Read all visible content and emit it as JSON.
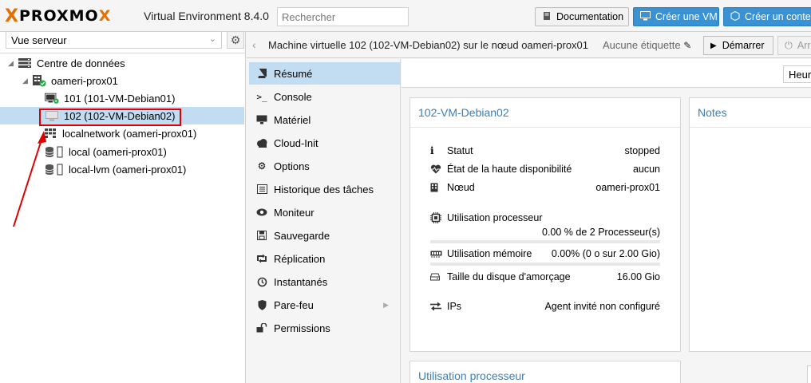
{
  "topbar": {
    "logo_x": "X",
    "logo_text": "PROXMO",
    "logo_x2": "X",
    "env": "Virtual Environment 8.4.0",
    "search_placeholder": "Rechercher",
    "doc_label": "Documentation",
    "create_vm_label": "Créer une VM",
    "create_ct_label": "Créer un conteneur"
  },
  "sidebar": {
    "view_selector": "Vue serveur",
    "tree": [
      {
        "label": "Centre de données",
        "icon": "server-rack-icon"
      },
      {
        "label": "oameri-prox01",
        "icon": "node-online-icon"
      },
      {
        "label": "101 (101-VM-Debian01)",
        "icon": "vm-running-icon"
      },
      {
        "label": "102 (102-VM-Debian02)",
        "icon": "vm-stopped-icon"
      },
      {
        "label": "localnetwork (oameri-prox01)",
        "icon": "network-grid-icon"
      },
      {
        "label": "local (oameri-prox01)",
        "icon": "storage-icon"
      },
      {
        "label": "local-lvm (oameri-prox01)",
        "icon": "storage-icon"
      }
    ]
  },
  "header": {
    "title": "Machine virtuelle 102 (102-VM-Debian02) sur le nœud oameri-prox01",
    "no_tag": "Aucune étiquette",
    "start_label": "Démarrer",
    "stop_label": "Arrêter"
  },
  "menu": [
    {
      "label": "Résumé",
      "icon": "book-icon",
      "selected": true
    },
    {
      "label": "Console",
      "icon": "terminal-icon"
    },
    {
      "label": "Matériel",
      "icon": "monitor-icon"
    },
    {
      "label": "Cloud-Init",
      "icon": "cloud-icon"
    },
    {
      "label": "Options",
      "icon": "gear-icon"
    },
    {
      "label": "Historique des tâches",
      "icon": "list-icon"
    },
    {
      "label": "Moniteur",
      "icon": "eye-icon"
    },
    {
      "label": "Sauvegarde",
      "icon": "floppy-icon"
    },
    {
      "label": "Réplication",
      "icon": "retweet-icon"
    },
    {
      "label": "Instantanés",
      "icon": "history-icon"
    },
    {
      "label": "Pare-feu",
      "icon": "shield-icon"
    },
    {
      "label": "Permissions",
      "icon": "unlock-icon"
    }
  ],
  "toolbar": {
    "timeframe": "Heure"
  },
  "summary": {
    "title": "102-VM-Debian02",
    "rows": {
      "status": {
        "label": "Statut",
        "value": "stopped"
      },
      "ha": {
        "label": "État de la haute disponibilité",
        "value": "aucun"
      },
      "node": {
        "label": "Nœud",
        "value": "oameri-prox01"
      },
      "cpu": {
        "label": "Utilisation processeur",
        "value": "0.00 % de 2 Processeur(s)",
        "fraction": 0
      },
      "mem": {
        "label": "Utilisation mémoire",
        "value": "0.00% (0 o sur 2.00 Gio)",
        "fraction": 0
      },
      "disk": {
        "label": "Taille du disque d'amorçage",
        "value": "16.00 Gio"
      },
      "ips": {
        "label": "IPs",
        "value": "Agent invité non configuré"
      }
    }
  },
  "notes": {
    "title": "Notes"
  },
  "cpu_chart": {
    "title": "Utilisation processeur"
  },
  "colors": {
    "accent": "#3892d4",
    "brand_orange": "#e57000",
    "selected_row": "#c2ddf2",
    "highlight_red": "#e00000"
  }
}
